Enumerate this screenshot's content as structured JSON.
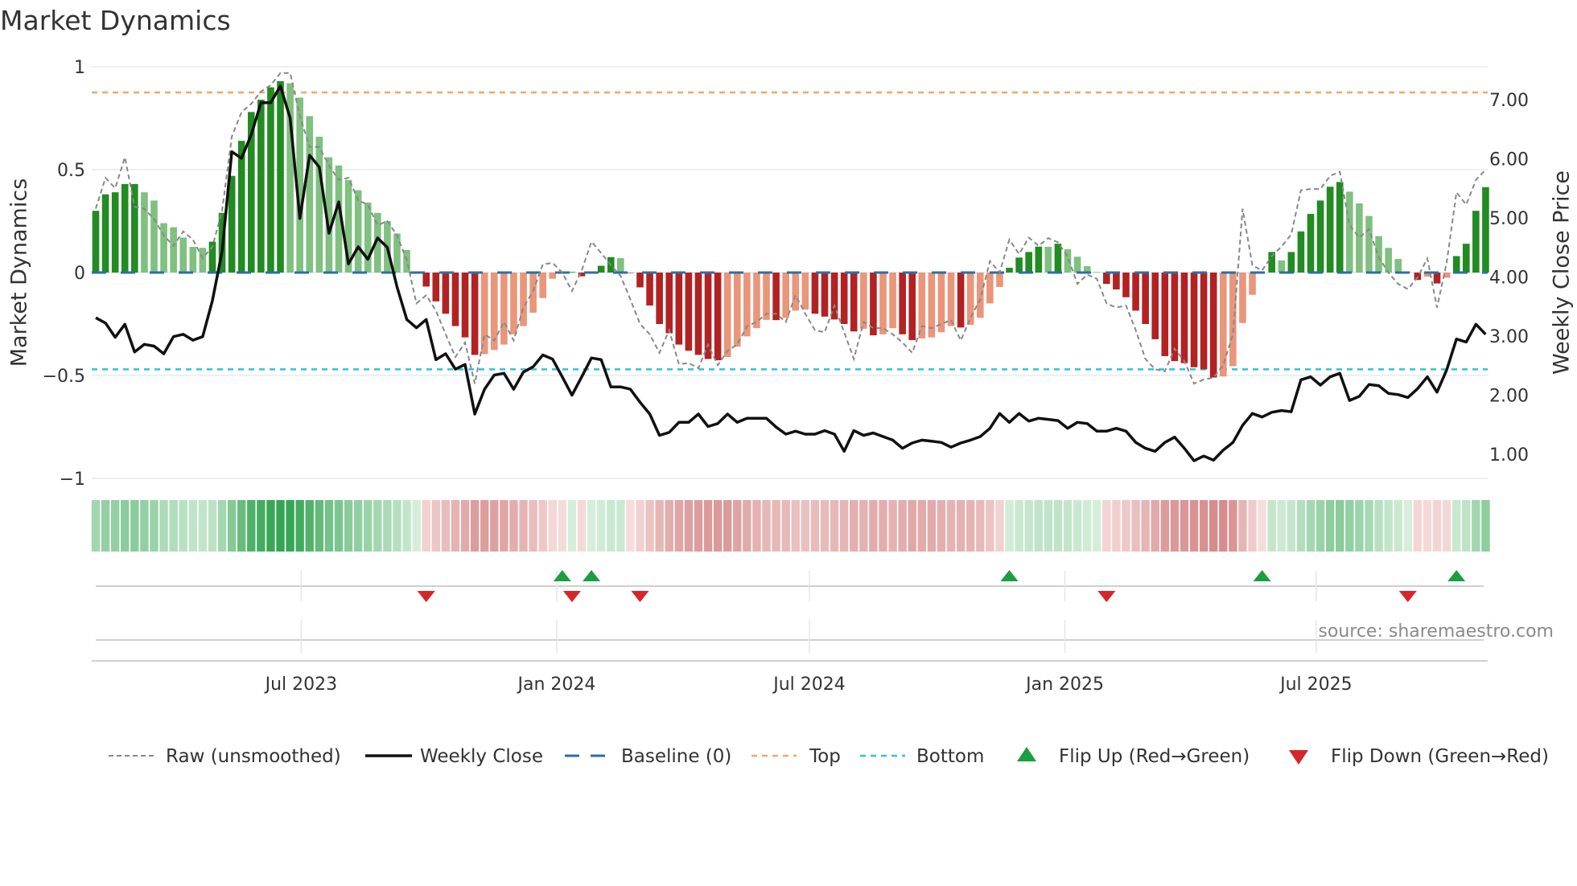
{
  "chart_data": {
    "type": "bar",
    "title": "Market Dynamics",
    "ylabel": "Market Dynamics",
    "y2label": "Weekly Close Price",
    "ylim": [
      -1,
      1
    ],
    "y2lim": [
      0.58,
      7.54
    ],
    "yticks": [
      {
        "value": 1,
        "label": "1"
      },
      {
        "value": 0.5,
        "label": "0.5"
      },
      {
        "value": 0,
        "label": "0"
      },
      {
        "value": -0.5,
        "label": "−0.5"
      },
      {
        "value": -1,
        "label": "−1"
      }
    ],
    "y2ticks": [
      {
        "value": 7,
        "label": "7.00"
      },
      {
        "value": 6,
        "label": "6.00"
      },
      {
        "value": 5,
        "label": "5.00"
      },
      {
        "value": 4,
        "label": "4.00"
      },
      {
        "value": 3,
        "label": "3.00"
      },
      {
        "value": 2,
        "label": "2.00"
      },
      {
        "value": 1,
        "label": "1.00"
      }
    ],
    "xticks": [
      {
        "date": "2023-07-01",
        "label": "Jul 2023"
      },
      {
        "date": "2024-01-01",
        "label": "Jan 2024"
      },
      {
        "date": "2024-07-01",
        "label": "Jul 2024"
      },
      {
        "date": "2025-01-01",
        "label": "Jan 2025"
      },
      {
        "date": "2025-07-01",
        "label": "Jul 2025"
      }
    ],
    "x_start": "2023-02-03",
    "x_step_days": 7,
    "grid": true,
    "legend_position": "bottom",
    "reference_lines": {
      "top": 0.875,
      "bottom": -0.47,
      "baseline": 0
    },
    "series": [
      {
        "name": "Market Dynamics (smoothed)",
        "kind": "bar",
        "values": [
          0.3,
          0.38,
          0.39,
          0.43,
          0.43,
          0.39,
          0.35,
          0.24,
          0.22,
          0.17,
          0.125,
          0.12,
          0.15,
          0.29,
          0.47,
          0.64,
          0.78,
          0.84,
          0.9,
          0.93,
          0.92,
          0.85,
          0.76,
          0.66,
          0.56,
          0.52,
          0.45,
          0.4,
          0.34,
          0.29,
          0.25,
          0.19,
          0.11,
          0.005,
          -0.068,
          -0.14,
          -0.2,
          -0.26,
          -0.315,
          -0.4,
          -0.396,
          -0.376,
          -0.35,
          -0.3,
          -0.26,
          -0.195,
          -0.124,
          -0.03,
          -0.004,
          0.003,
          -0.018,
          0.002,
          0.033,
          0.075,
          0.07,
          -0.002,
          -0.072,
          -0.16,
          -0.25,
          -0.295,
          -0.35,
          -0.38,
          -0.4,
          -0.42,
          -0.426,
          -0.41,
          -0.36,
          -0.31,
          -0.27,
          -0.23,
          -0.231,
          -0.22,
          -0.185,
          -0.18,
          -0.2,
          -0.214,
          -0.228,
          -0.25,
          -0.286,
          -0.273,
          -0.305,
          -0.3,
          -0.27,
          -0.3,
          -0.328,
          -0.32,
          -0.315,
          -0.29,
          -0.26,
          -0.267,
          -0.254,
          -0.22,
          -0.15,
          -0.07,
          0.023,
          0.073,
          0.1,
          0.126,
          0.125,
          0.14,
          0.113,
          0.077,
          0.031,
          0.003,
          -0.055,
          -0.082,
          -0.12,
          -0.185,
          -0.25,
          -0.324,
          -0.406,
          -0.43,
          -0.44,
          -0.46,
          -0.47,
          -0.51,
          -0.505,
          -0.455,
          -0.245,
          -0.108,
          -0.002,
          0.1,
          0.059,
          0.1,
          0.2,
          0.285,
          0.35,
          0.417,
          0.44,
          0.393,
          0.336,
          0.275,
          0.177,
          0.12,
          0.066,
          0.002,
          -0.036,
          -0.02,
          -0.053,
          -0.025,
          0.08,
          0.14,
          0.3,
          0.415
        ]
      },
      {
        "name": "Raw (unsmoothed)",
        "kind": "line",
        "values": [
          0.31,
          0.46,
          0.41,
          0.56,
          0.32,
          0.31,
          0.26,
          0.18,
          0.13,
          0.2,
          0.16,
          0.07,
          0.125,
          0.3,
          0.66,
          0.78,
          0.82,
          0.88,
          0.91,
          0.97,
          0.97,
          0.76,
          0.61,
          0.61,
          0.52,
          0.45,
          0.46,
          0.35,
          0.33,
          0.23,
          0.25,
          0.18,
          0.06,
          -0.15,
          -0.11,
          -0.185,
          -0.3,
          -0.41,
          -0.34,
          -0.54,
          -0.3,
          -0.33,
          -0.24,
          -0.33,
          -0.17,
          -0.09,
          0.04,
          0.047,
          0,
          -0.09,
          0.01,
          0.15,
          0.095,
          0.036,
          -0.016,
          -0.13,
          -0.25,
          -0.3,
          -0.39,
          -0.28,
          -0.445,
          -0.44,
          -0.465,
          -0.35,
          -0.45,
          -0.38,
          -0.35,
          -0.26,
          -0.24,
          -0.2,
          -0.2,
          -0.24,
          -0.11,
          -0.2,
          -0.28,
          -0.29,
          -0.16,
          -0.29,
          -0.42,
          -0.24,
          -0.27,
          -0.27,
          -0.3,
          -0.34,
          -0.39,
          -0.26,
          -0.27,
          -0.25,
          -0.23,
          -0.33,
          -0.22,
          -0.13,
          0.056,
          0,
          0.16,
          0.09,
          0.17,
          0.13,
          0.167,
          0.147,
          0.076,
          -0.055,
          -0.01,
          -0.03,
          -0.15,
          -0.17,
          -0.16,
          -0.28,
          -0.42,
          -0.47,
          -0.48,
          -0.37,
          -0.43,
          -0.54,
          -0.52,
          -0.51,
          -0.45,
          -0.3,
          0.31,
          0.035,
          0.01,
          0.08,
          0.126,
          0.185,
          0.4,
          0.406,
          0.406,
          0.47,
          0.49,
          0.23,
          0.17,
          0.21,
          0.074,
          0,
          -0.056,
          -0.08,
          -0.023,
          0.068,
          -0.17,
          0.05,
          0.39,
          0.33,
          0.45,
          0.5
        ]
      },
      {
        "name": "Weekly Close",
        "kind": "line",
        "axis": "right",
        "values": [
          3.31,
          3.22,
          2.98,
          3.2,
          2.73,
          2.86,
          2.83,
          2.7,
          2.99,
          3.03,
          2.93,
          2.99,
          3.6,
          4.43,
          6.12,
          6.01,
          6.41,
          6.95,
          6.95,
          7.23,
          6.69,
          4.99,
          6.06,
          5.86,
          4.74,
          5.27,
          4.22,
          4.51,
          4.3,
          4.66,
          4.5,
          3.83,
          3.28,
          3.14,
          3.28,
          2.6,
          2.7,
          2.44,
          2.52,
          1.68,
          2.1,
          2.34,
          2.37,
          2.1,
          2.39,
          2.48,
          2.68,
          2.61,
          2.31,
          2.0,
          2.31,
          2.63,
          2.6,
          2.14,
          2.14,
          2.1,
          1.88,
          1.68,
          1.32,
          1.37,
          1.54,
          1.54,
          1.68,
          1.47,
          1.52,
          1.68,
          1.54,
          1.61,
          1.61,
          1.61,
          1.46,
          1.34,
          1.39,
          1.34,
          1.34,
          1.4,
          1.34,
          1.05,
          1.4,
          1.32,
          1.36,
          1.3,
          1.24,
          1.1,
          1.19,
          1.24,
          1.22,
          1.2,
          1.12,
          1.19,
          1.24,
          1.3,
          1.44,
          1.69,
          1.54,
          1.69,
          1.56,
          1.61,
          1.59,
          1.57,
          1.44,
          1.54,
          1.52,
          1.39,
          1.39,
          1.44,
          1.39,
          1.2,
          1.1,
          1.05,
          1.2,
          1.29,
          1.1,
          0.89,
          0.97,
          0.9,
          1.07,
          1.2,
          1.49,
          1.69,
          1.63,
          1.71,
          1.74,
          1.72,
          2.26,
          2.31,
          2.17,
          2.31,
          2.37,
          1.91,
          1.98,
          2.18,
          2.16,
          2.03,
          2.01,
          1.96,
          2.11,
          2.31,
          2.05,
          2.43,
          2.95,
          2.9,
          3.2,
          3.03
        ]
      }
    ],
    "flip_up_dates": [
      "2024-01-05",
      "2024-01-26",
      "2024-11-22",
      "2025-05-23",
      "2025-10-10"
    ],
    "flip_down_dates": [
      "2023-09-29",
      "2024-01-12",
      "2024-03-01",
      "2025-01-31",
      "2025-09-05"
    ],
    "legend": [
      {
        "label": "Raw (unsmoothed)",
        "style": "dashed-gray"
      },
      {
        "label": "Weekly Close",
        "style": "solid-black"
      },
      {
        "label": "Baseline (0)",
        "style": "dashed-blue"
      },
      {
        "label": "Top",
        "style": "dashed-orange"
      },
      {
        "label": "Bottom",
        "style": "dashed-cyan"
      },
      {
        "label": "Flip Up (Red→Green)",
        "style": "triangle-up-green"
      },
      {
        "label": "Flip Down (Green→Red)",
        "style": "triangle-down-red"
      }
    ],
    "colors": {
      "green_strong": "#228b22",
      "green_weak": "#80c080",
      "red_strong": "#b22222",
      "red_weak": "#e9967a",
      "baseline": "#2b6ea8",
      "top": "#f0a868",
      "bottom": "#2ec4d4",
      "raw": "#888888",
      "close": "#111111",
      "flip_up": "#1a9e3f",
      "flip_down": "#d62728"
    },
    "source": "source: sharemaestro.com"
  }
}
